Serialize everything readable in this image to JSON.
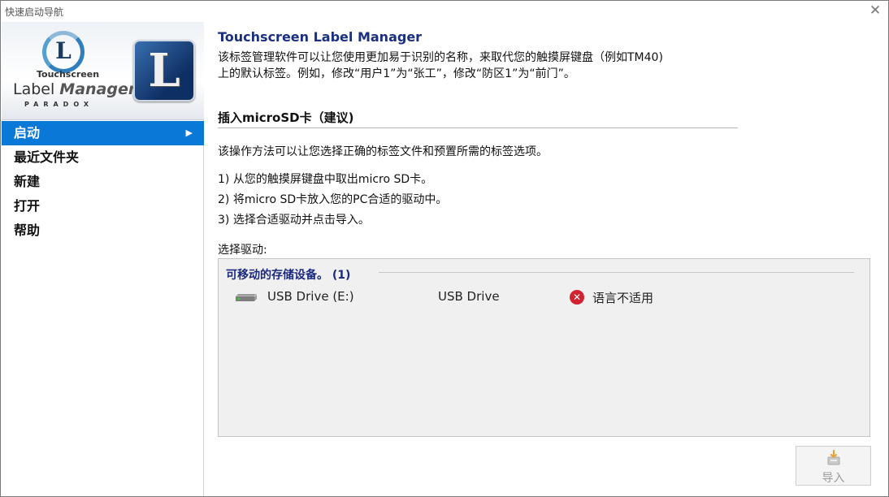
{
  "window": {
    "title": "快速启动导航",
    "close_glyph": "✕"
  },
  "logo": {
    "small_text": "Touchscreen",
    "big_text_a": "Label ",
    "big_text_b": "Manager",
    "sub_text": "PARADOX",
    "letter": "L"
  },
  "nav": {
    "items": [
      {
        "label": "启动",
        "active": true
      },
      {
        "label": "最近文件夹"
      },
      {
        "label": "新建"
      },
      {
        "label": "打开"
      },
      {
        "label": "帮助"
      }
    ],
    "active_arrow": "▶"
  },
  "main": {
    "app_title": "Touchscreen Label Manager",
    "description_line1": "该标签管理软件可以让您使用更加易于识别的名称，来取代您的触摸屏键盘（例如TM40)",
    "description_line2": "上的默认标签。例如，修改“用户1”为“张工”，修改“防区1”为“前门”。",
    "section_title": "插入microSD卡（建议)",
    "intro": "该操作方法可以让您选择正确的标签文件和预置所需的标签选项。",
    "steps": [
      "1)  从您的触摸屏键盘中取出micro SD卡。",
      "2)  将micro SD卡放入您的PC合适的驱动中。",
      "3)  选择合适驱动并点击导入。"
    ],
    "drive_label": "选择驱动:"
  },
  "drives": {
    "group_header": "可移动的存储设备。 (1)",
    "items": [
      {
        "name": "USB Drive (E:)",
        "type": "USB Drive",
        "status": "语言不适用",
        "status_icon": "error-icon"
      }
    ]
  },
  "actions": {
    "import_label": "导入"
  },
  "colors": {
    "accent": "#0a78d7",
    "title_blue": "#1b2f80",
    "error_red": "#d3222f"
  }
}
